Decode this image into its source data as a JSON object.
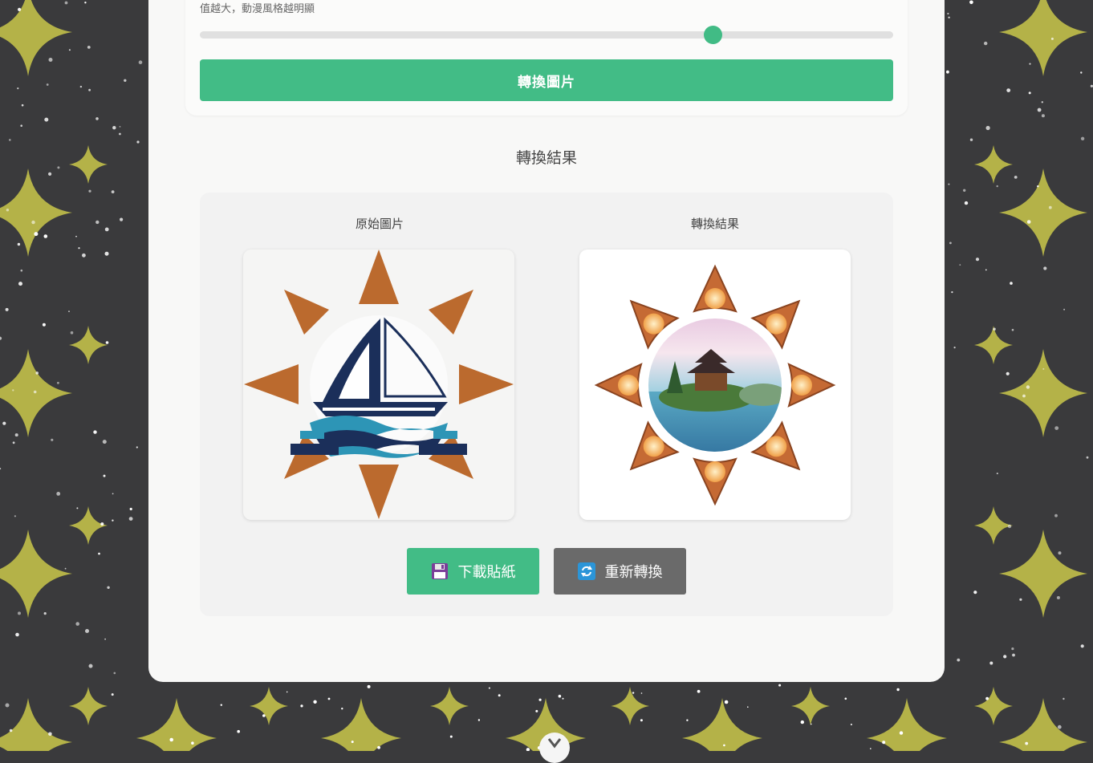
{
  "settings": {
    "hint_text": "值越大，動漫風格越明顯",
    "style_strength": 0.74,
    "convert_button": "轉換圖片"
  },
  "result": {
    "section_title": "轉換結果",
    "original_label": "原始圖片",
    "converted_label": "轉換結果",
    "download_button": "下載貼紙",
    "reconvert_button": "重新轉換"
  },
  "icons": {
    "download": "floppy-disk-icon",
    "reconvert": "refresh-icon",
    "scroll": "chevron-down-icon"
  },
  "colors": {
    "accent": "#42bc86",
    "secondary_button": "#6a6a6a",
    "background_star": "#b4b248",
    "background_dark": "#3a3a3c"
  }
}
